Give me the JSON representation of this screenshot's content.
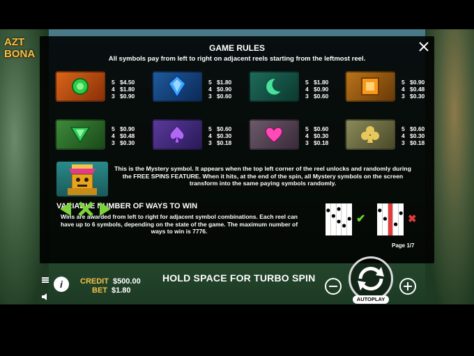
{
  "game": {
    "logo_line1": "AZT",
    "logo_line2": "BONA"
  },
  "rules": {
    "title": "GAME RULES",
    "subtitle": "All symbols pay from left to right on adjacent reels starting from the leftmost reel.",
    "symbols": [
      {
        "icon": "emerald-gem-orange-tile",
        "pays": [
          [
            "5",
            "$4.50"
          ],
          [
            "4",
            "$1.80"
          ],
          [
            "3",
            "$0.90"
          ]
        ]
      },
      {
        "icon": "blue-crystal-gem-tile",
        "pays": [
          [
            "5",
            "$1.80"
          ],
          [
            "4",
            "$0.90"
          ],
          [
            "3",
            "$0.60"
          ]
        ]
      },
      {
        "icon": "green-moon-gem-tile",
        "pays": [
          [
            "5",
            "$1.80"
          ],
          [
            "4",
            "$0.90"
          ],
          [
            "3",
            "$0.60"
          ]
        ]
      },
      {
        "icon": "orange-square-gem-tile",
        "pays": [
          [
            "5",
            "$0.90"
          ],
          [
            "4",
            "$0.48"
          ],
          [
            "3",
            "$0.30"
          ]
        ]
      },
      {
        "icon": "green-diamond-tile",
        "pays": [
          [
            "5",
            "$0.90"
          ],
          [
            "4",
            "$0.48"
          ],
          [
            "3",
            "$0.30"
          ]
        ]
      },
      {
        "icon": "purple-spade-tile",
        "pays": [
          [
            "5",
            "$0.60"
          ],
          [
            "4",
            "$0.30"
          ],
          [
            "3",
            "$0.18"
          ]
        ]
      },
      {
        "icon": "pink-heart-tile",
        "pays": [
          [
            "5",
            "$0.60"
          ],
          [
            "4",
            "$0.30"
          ],
          [
            "3",
            "$0.18"
          ]
        ]
      },
      {
        "icon": "gold-club-tile",
        "pays": [
          [
            "5",
            "$0.60"
          ],
          [
            "4",
            "$0.30"
          ],
          [
            "3",
            "$0.18"
          ]
        ]
      }
    ],
    "mystery_text": "This is the Mystery symbol. It appears when the top left corner of the reel unlocks and randomly during the FREE SPINS FEATURE. When it hits, at the end of the spin, all Mystery symbols on the screen transform into the same paying symbols randomly.",
    "ways_title": "VARIABLE NUMBER OF WAYS TO WIN",
    "ways_text": "Wins are awarded from left to right for adjacent symbol combinations. Each reel can have up to 6 symbols, depending on the state of the game. The maximum number of ways to win is 7776.",
    "page": "Page 1/7"
  },
  "hud": {
    "credit_label": "CREDIT",
    "credit_value": "$500.00",
    "bet_label": "BET",
    "bet_value": "$1.80",
    "message": "HOLD SPACE FOR TURBO SPIN",
    "autoplay": "AUTOPLAY"
  },
  "colors": {
    "accent": "#f3c34a",
    "nav_green": "#7fd33a",
    "valid": "#6fd62a",
    "invalid": "#e23b3b"
  }
}
